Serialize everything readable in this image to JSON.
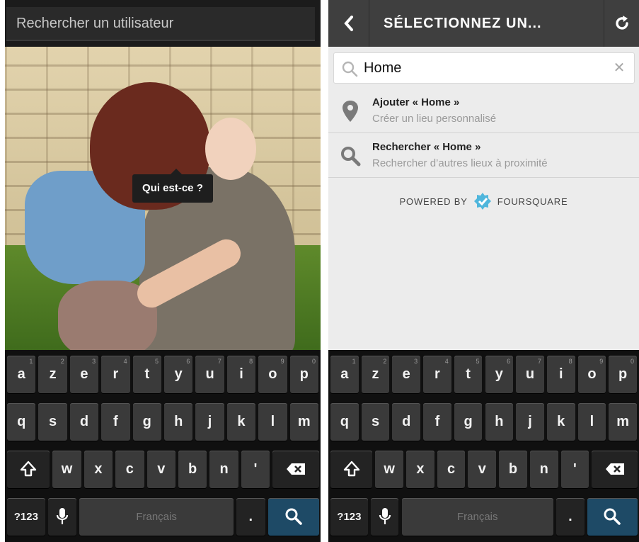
{
  "left": {
    "search": {
      "placeholder": "Rechercher un utilisateur",
      "value": ""
    },
    "tag_label": "Qui est-ce ?"
  },
  "right": {
    "header": {
      "title": "SÉLECTIONNEZ UN..."
    },
    "search": {
      "value": "Home"
    },
    "results": [
      {
        "title": "Ajouter « Home »",
        "subtitle": "Créer un lieu personnalisé",
        "icon": "map-pin-icon"
      },
      {
        "title": "Rechercher « Home »",
        "subtitle": "Rechercher d’autres lieux à proximité",
        "icon": "search-icon"
      }
    ],
    "powered": {
      "prefix": "POWERED BY",
      "brand": "FOURSQUARE"
    }
  },
  "keyboard": {
    "row1": [
      "a",
      "z",
      "e",
      "r",
      "t",
      "y",
      "u",
      "i",
      "o",
      "p"
    ],
    "row1_hints": [
      "1",
      "2",
      "3",
      "4",
      "5",
      "6",
      "7",
      "8",
      "9",
      "0"
    ],
    "row2": [
      "q",
      "s",
      "d",
      "f",
      "g",
      "h",
      "j",
      "k",
      "l",
      "m"
    ],
    "row3": [
      "w",
      "x",
      "c",
      "v",
      "b",
      "n",
      "'"
    ],
    "sym_label": "?123",
    "space_label": "Français",
    "period_label": ".",
    "shift_icon": "shift-icon",
    "backspace_icon": "backspace-icon",
    "mic_icon": "microphone-icon",
    "go_icon": "search-icon"
  },
  "colors": {
    "header": "#3f3f3f",
    "go_key": "#1e4a66",
    "foursquare": "#4fb6dc"
  }
}
